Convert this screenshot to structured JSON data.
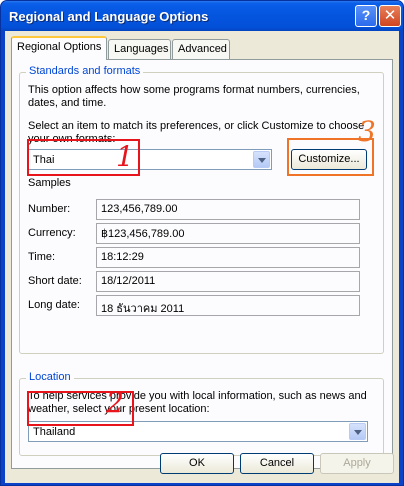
{
  "window": {
    "title": "Regional and Language Options",
    "help_glyph": "?",
    "close_glyph": "✕"
  },
  "tabs": [
    {
      "label": "Regional Options",
      "active": true
    },
    {
      "label": "Languages",
      "active": false
    },
    {
      "label": "Advanced",
      "active": false
    }
  ],
  "standards": {
    "legend": "Standards and formats",
    "description": "This option affects how some programs format numbers, currencies, dates, and time.",
    "instruction": "Select an item to match its preferences, or click Customize to choose your own formats:",
    "selected_format": "Thai",
    "customize_label": "Customize...",
    "samples_heading": "Samples",
    "samples": [
      {
        "label": "Number:",
        "value": "123,456,789.00"
      },
      {
        "label": "Currency:",
        "value": "฿123,456,789.00"
      },
      {
        "label": "Time:",
        "value": "18:12:29"
      },
      {
        "label": "Short date:",
        "value": "18/12/2011"
      },
      {
        "label": "Long date:",
        "value": "18 ธันวาคม 2011"
      }
    ]
  },
  "location": {
    "legend": "Location",
    "description": "To help services provide you with local information, such as news and weather, select your present location:",
    "selected_location": "Thailand"
  },
  "footer": {
    "ok_label": "OK",
    "cancel_label": "Cancel",
    "apply_label": "Apply"
  },
  "annotations": [
    {
      "number": "1",
      "color": "#e8141c"
    },
    {
      "number": "2",
      "color": "#e8141c"
    },
    {
      "number": "3",
      "color": "#f07428"
    }
  ]
}
